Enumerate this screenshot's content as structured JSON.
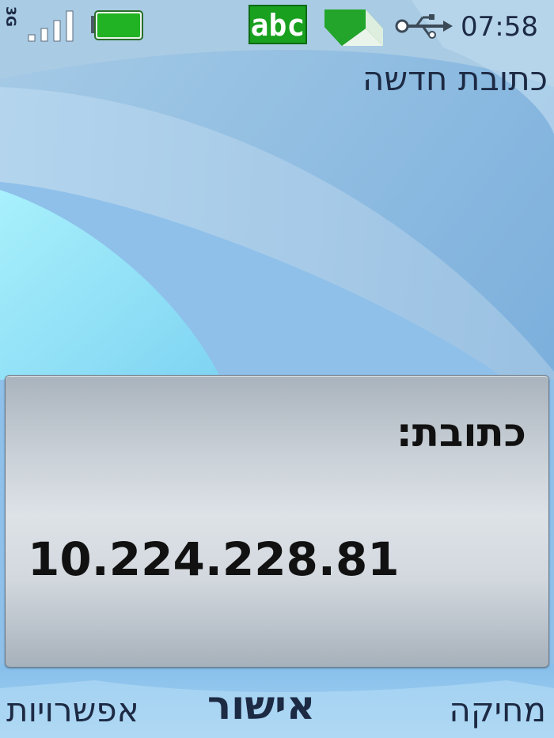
{
  "status_bar": {
    "network": "3G",
    "signal_bars": 4,
    "battery_level": 1.0,
    "input_mode": "abc",
    "time": "07:58",
    "icons": [
      "3g-icon",
      "signal-icon",
      "battery-icon",
      "abc-input-icon",
      "pencil-icon",
      "usb-icon"
    ]
  },
  "title": "כתובת חדשה",
  "form": {
    "label": "כתובת:",
    "value": "10.224.228.81"
  },
  "softkeys": {
    "left": "אפשרויות",
    "center": "אישור",
    "right": "מחיקה"
  },
  "colors": {
    "text": "#1d2a44",
    "input_badge": "#19a01f",
    "battery": "#22b324"
  }
}
